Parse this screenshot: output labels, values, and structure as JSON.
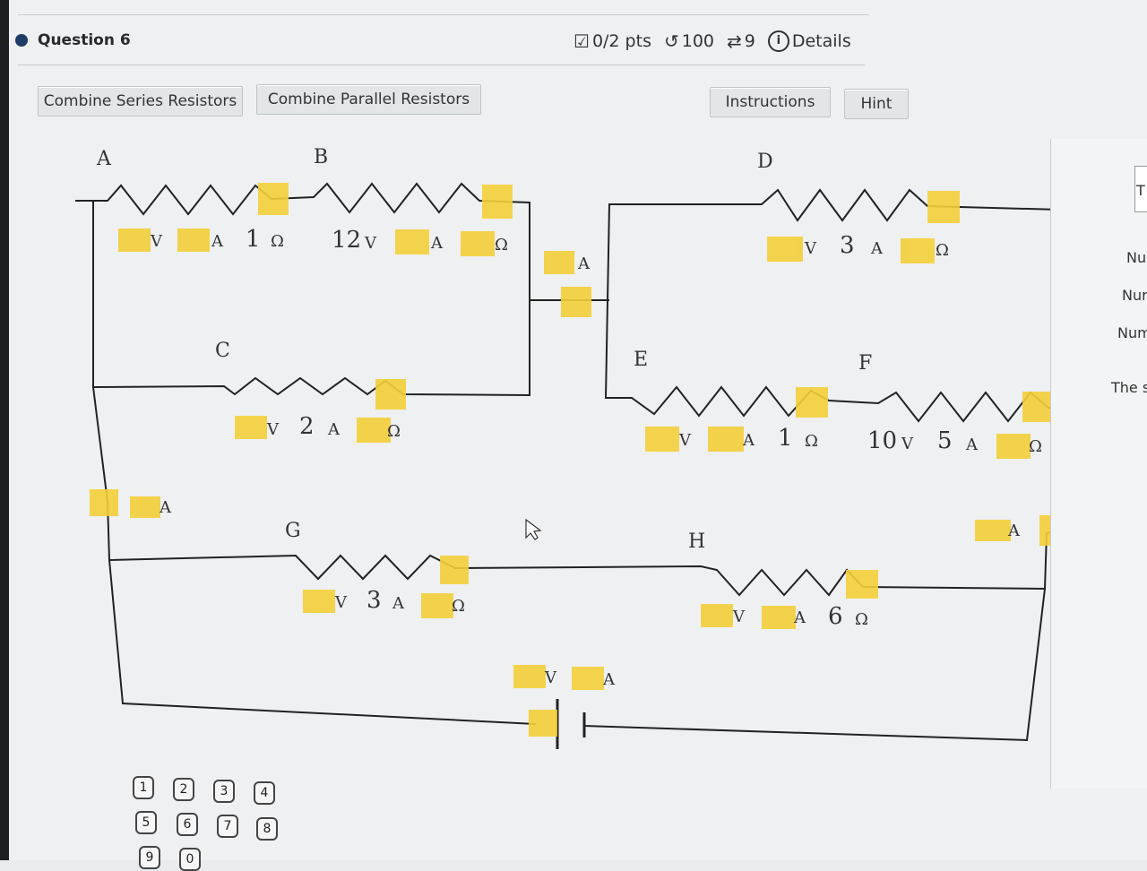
{
  "question": {
    "title": "Question 6"
  },
  "score": {
    "points": "0/2 pts",
    "attempts": "100",
    "retries": "9",
    "details": "Details"
  },
  "toolbar": {
    "series": "Combine Series Resistors",
    "parallel": "Combine Parallel Resistors",
    "instructions": "Instructions",
    "hint": "Hint"
  },
  "labels": {
    "A": "A",
    "B": "B",
    "C": "C",
    "D": "D",
    "E": "E",
    "F": "F",
    "G": "G",
    "H": "H"
  },
  "values": {
    "A": [
      "V",
      "A",
      "1",
      "Ω"
    ],
    "B": [
      "12",
      "V",
      "A",
      "Ω"
    ],
    "mid_current": "A",
    "D": [
      "V",
      "3",
      "A",
      "Ω"
    ],
    "C": [
      "V",
      "2",
      "A",
      "Ω"
    ],
    "E": [
      "V",
      "A",
      "1",
      "Ω"
    ],
    "F": [
      "10",
      "V",
      "5",
      "A",
      "Ω"
    ],
    "left_current": "A",
    "right_current": "A",
    "G": [
      "V",
      "3",
      "A",
      "Ω"
    ],
    "H": [
      "V",
      "A",
      "6",
      "Ω"
    ],
    "battery": [
      "V",
      "A"
    ]
  },
  "side": [
    "T",
    "Nu",
    "Nur",
    "Num",
    "The s"
  ],
  "keypad": [
    "1",
    "2",
    "3",
    "4",
    "5",
    "6",
    "7",
    "8",
    "9",
    "0"
  ],
  "colors": {
    "highlight": "#f4cf3a",
    "wire": "#222222"
  }
}
